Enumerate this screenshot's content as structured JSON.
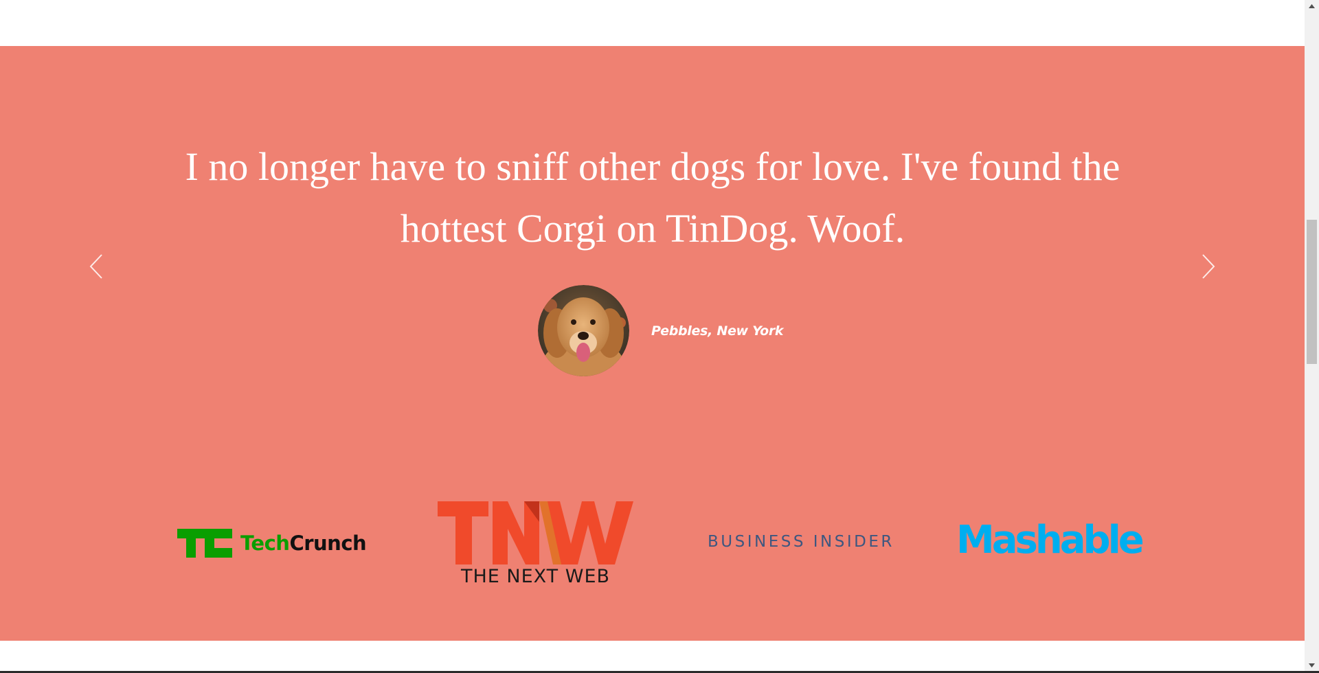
{
  "testimonial": {
    "quote": "I no longer have to sniff other dogs for love. I've found the hottest Corgi on TinDog. Woof.",
    "author": "Pebbles, New York"
  },
  "carousel": {
    "prev_icon": "chevron-left-icon",
    "next_icon": "chevron-right-icon"
  },
  "press": {
    "techcrunch": {
      "part1": "Tech",
      "part2": "Crunch"
    },
    "tnw": {
      "subtitle": "THE NEXT WEB"
    },
    "business_insider": "BUSINESS INSIDER",
    "mashable": "Mashable"
  },
  "colors": {
    "band_background": "#ef8172",
    "techcrunch_green": "#0a9e01",
    "tnw_orange": "#f04a2b",
    "business_insider_blue": "#3d5780",
    "mashable_blue": "#00aeef"
  }
}
